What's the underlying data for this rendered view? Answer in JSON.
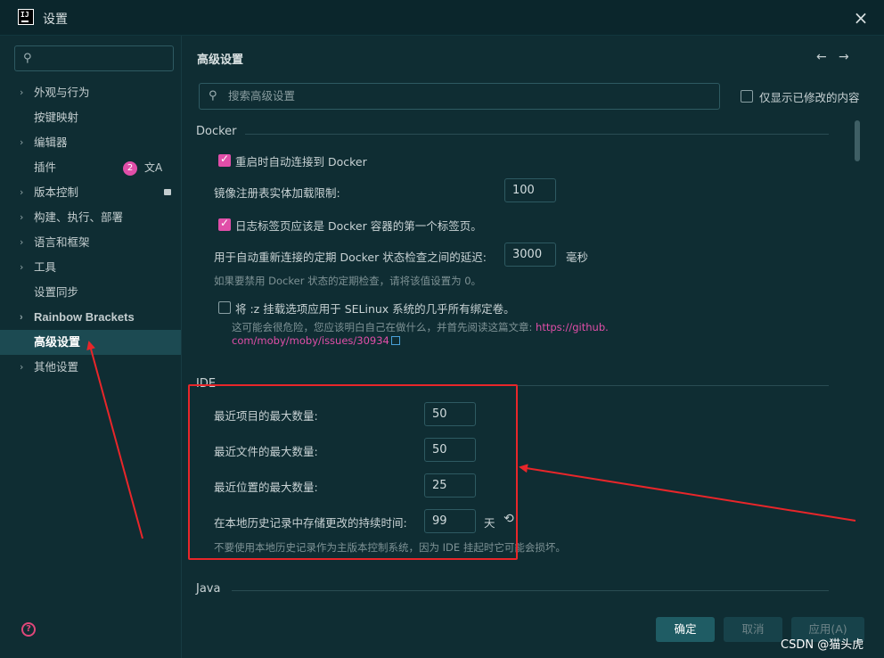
{
  "window": {
    "title": "设置",
    "app_icon": "intellij-icon",
    "close_icon": "×"
  },
  "sidebar": {
    "search_icon": "⚲",
    "items": [
      {
        "label": "外观与行为",
        "chevron": "›"
      },
      {
        "label": "按键映射"
      },
      {
        "label": "编辑器",
        "chevron": "›"
      },
      {
        "label": "插件",
        "badge": "2",
        "extra_icon": "文A"
      },
      {
        "label": "版本控制",
        "chevron": "›"
      },
      {
        "label": "构建、执行、部署",
        "chevron": "›"
      },
      {
        "label": "语言和框架",
        "chevron": "›"
      },
      {
        "label": "工具",
        "chevron": "›"
      },
      {
        "label": "设置同步"
      },
      {
        "label": "Rainbow Brackets",
        "chevron": "›"
      },
      {
        "label": "高级设置"
      },
      {
        "label": "其他设置",
        "chevron": "›"
      }
    ],
    "help": "?"
  },
  "main": {
    "title": "高级设置",
    "back": "←",
    "forward": "→",
    "search_placeholder": "搜索高级设置",
    "modified_only": "仅显示已修改的内容",
    "docker": {
      "section": "Docker",
      "reconnect": "重启时自动连接到 Docker",
      "image_limit_label": "镜像注册表实体加载限制:",
      "image_limit_value": "100",
      "logs_first": "日志标签页应该是 Docker 容器的第一个标签页。",
      "delay_label": "用于自动重新连接的定期 Docker 状态检查之间的延迟:",
      "delay_value": "3000",
      "delay_unit": "毫秒",
      "delay_hint": "如果要禁用 Docker 状态的定期检查，请将该值设置为 0。",
      "selinux": "将 :z 挂载选项应用于 SELinux 系统的几乎所有绑定卷。",
      "selinux_hint": "这可能会很危险，您应该明白自己在做什么，并首先阅读这篇文章:",
      "selinux_link1": "https://github.",
      "selinux_link2": "com/moby/moby/issues/30934"
    },
    "ide": {
      "section": "IDE",
      "recent_projects_label": "最近项目的最大数量:",
      "recent_projects_value": "50",
      "recent_files_label": "最近文件的最大数量:",
      "recent_files_value": "50",
      "recent_locations_label": "最近位置的最大数量:",
      "recent_locations_value": "25",
      "history_label": "在本地历史记录中存储更改的持续时间:",
      "history_value": "99",
      "history_unit": "天",
      "history_hint": "不要使用本地历史记录作为主版本控制系统，因为 IDE 挂起时它可能会损坏。"
    },
    "java": {
      "section": "Java"
    }
  },
  "footer": {
    "ok": "确定",
    "cancel": "取消",
    "apply": "应用(A)"
  },
  "watermark": "CSDN @猫头虎",
  "colors": {
    "accent": "#e04ea8",
    "annotation": "#e8262a",
    "background": "#0f2d33"
  }
}
